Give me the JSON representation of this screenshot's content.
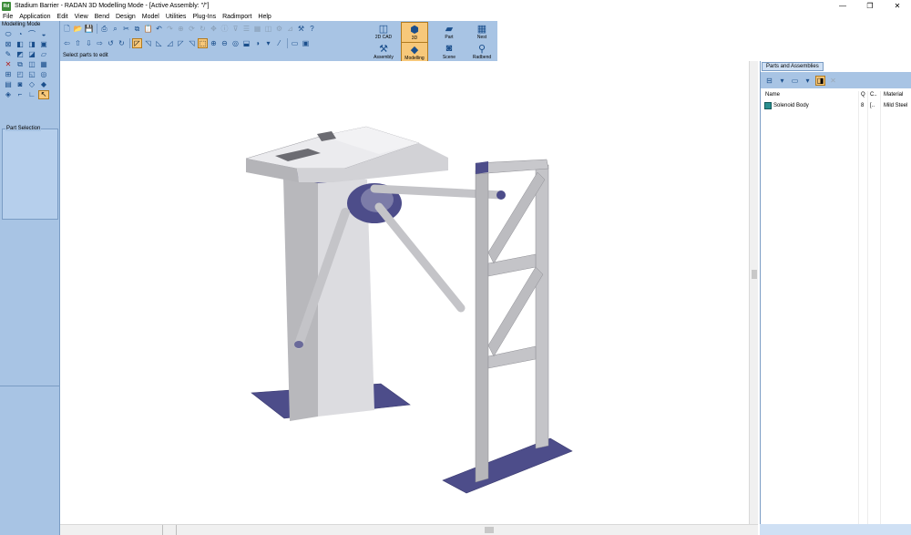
{
  "window": {
    "app_icon_text": "Rd",
    "title": "Stadium Barrier - RADAN 3D Modelling Mode - [Active Assembly: \"/\"]",
    "minimize": "—",
    "maximize": "❐",
    "close": "✕"
  },
  "menu": [
    "File",
    "Application",
    "Edit",
    "View",
    "Bend",
    "Design",
    "Model",
    "Utilities",
    "Plug-Ins",
    "Radimport",
    "Help"
  ],
  "left_panel": {
    "mode_label": "Modelling Mode",
    "part_selection_label": "Part Selection"
  },
  "status": {
    "text": "Select parts to edit"
  },
  "mode_buttons": {
    "cad2d": "2D CAD",
    "three_d": "3D",
    "part": "Part",
    "nest": "Nest",
    "assembly": "Assembly",
    "modelling": "Modelling",
    "scene": "Scene",
    "radbend": "Radbend"
  },
  "right_panel": {
    "tab": "Parts and Assemblies",
    "columns": {
      "name": "Name",
      "q": "Q",
      "c": "C..",
      "material": "Material"
    },
    "rows": [
      {
        "name": "Solenoid Body",
        "q": "8",
        "c": "[..",
        "material": "Mild Steel"
      }
    ]
  },
  "colors": {
    "panel_bg": "#a8c4e4",
    "active_tool": "#f7c87a",
    "model_grey": "#c8c8cc",
    "base_plate": "#4d4d8a"
  }
}
